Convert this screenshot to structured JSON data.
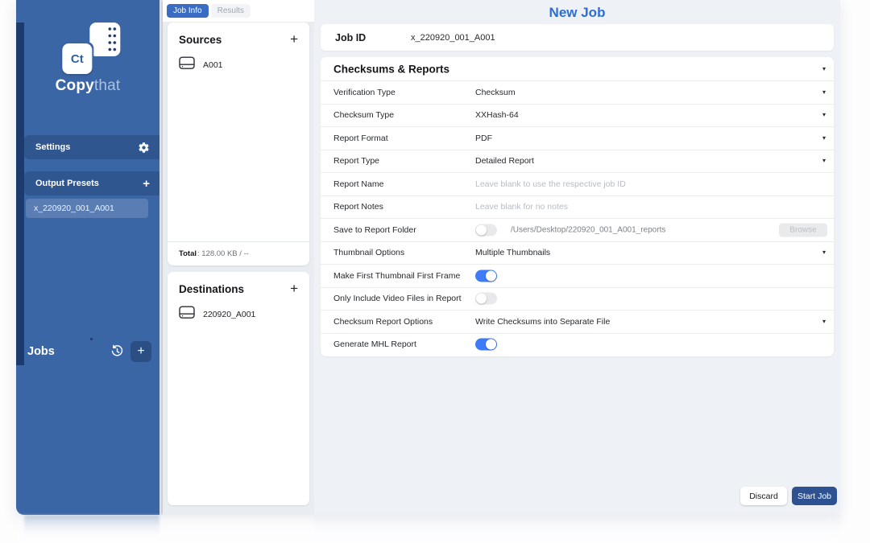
{
  "brand": {
    "badge": "Ct",
    "name_bold": "Copy",
    "name_light": "that"
  },
  "sidebar": {
    "settings_label": "Settings",
    "output_presets_label": "Output Presets",
    "output_presets_add": "+",
    "preset_item": "x_220920_001_A001",
    "jobs_label": "Jobs",
    "jobs_add": "+"
  },
  "tabs": {
    "job_info": "Job Info",
    "results": "Results"
  },
  "sources": {
    "title": "Sources",
    "add": "+",
    "item": "A001",
    "total_label": "Total",
    "total_value": ": 128.00 KB / --"
  },
  "destinations": {
    "title": "Destinations",
    "add": "+",
    "item": "220920_A001"
  },
  "main": {
    "title": "New Job",
    "job_id_label": "Job ID",
    "job_id_value": "x_220920_001_A001",
    "section_title": "Checksums & Reports",
    "rows": [
      {
        "label": "Verification Type",
        "type": "select",
        "value": "Checksum"
      },
      {
        "label": "Checksum Type",
        "type": "select",
        "value": "XXHash-64"
      },
      {
        "label": "Report Format",
        "type": "select",
        "value": "PDF"
      },
      {
        "label": "Report Type",
        "type": "select",
        "value": "Detailed Report"
      },
      {
        "label": "Report Name",
        "type": "input",
        "placeholder": "Leave blank to use the respective job ID"
      },
      {
        "label": "Report Notes",
        "type": "input",
        "placeholder": "Leave blank for no notes"
      },
      {
        "label": "Save to Report Folder",
        "type": "toggle_path",
        "enabled": false,
        "path": "/Users/Desktop/220920_001_A001_reports",
        "button_label": "Browse"
      },
      {
        "label": "Thumbnail Options",
        "type": "select",
        "value": "Multiple Thumbnails"
      },
      {
        "label": "Make First Thumbnail First Frame",
        "type": "toggle",
        "enabled": true
      },
      {
        "label": "Only Include Video Files in Report",
        "type": "toggle",
        "enabled": false
      },
      {
        "label": "Checksum Report Options",
        "type": "select",
        "value": "Write Checksums into Separate File"
      },
      {
        "label": "Generate MHL Report",
        "type": "toggle",
        "enabled": true
      }
    ],
    "discard_label": "Discard",
    "start_label": "Start Job"
  },
  "colors": {
    "sidebar_blue": "#3b66a6",
    "dark_strip": "#1c3a6b",
    "tab_active": "#3b6cc4",
    "title_blue": "#2e6ed2",
    "toggle_on": "#3e7bf6",
    "start_button": "#2d5191"
  }
}
